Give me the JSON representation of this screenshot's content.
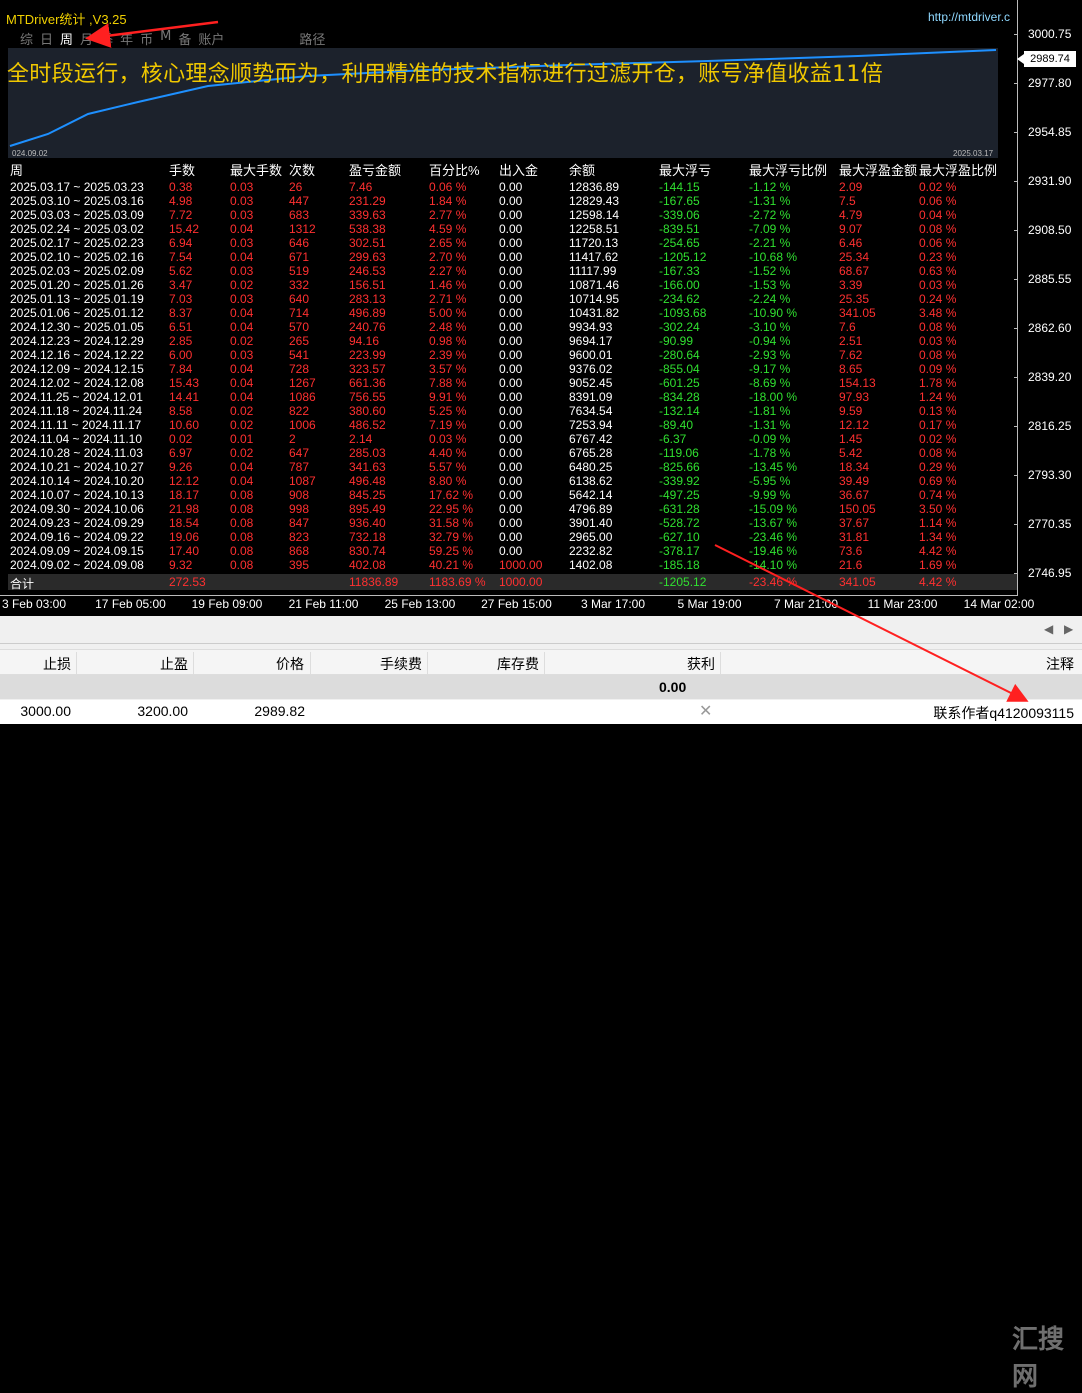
{
  "app": {
    "title": "MTDriver统计 ,V3.25",
    "url": "http://mtdriver.c"
  },
  "tabs": [
    "综",
    "日",
    "周",
    "月",
    "季",
    "年",
    "币",
    "M",
    "备",
    "账户",
    "路径"
  ],
  "active_tab": "周",
  "banner": "全时段运行，核心理念顺势而为，利用精准的技术指标进行过滤开仓，账号净值收益11倍",
  "mini_chart": {
    "start_label": "024.09.02",
    "end_label": "2025.03.17",
    "line_color": "#1e90ff",
    "bg": "#1c222c"
  },
  "price_axis": {
    "labels": [
      "3000.75",
      "2977.80",
      "2954.85",
      "2931.90",
      "2908.50",
      "2885.55",
      "2862.60",
      "2839.20",
      "2816.25",
      "2793.30",
      "2770.35",
      "2746.95"
    ],
    "current_price": "2989.74"
  },
  "time_axis": [
    "3 Feb 03:00",
    "17 Feb 05:00",
    "19 Feb 09:00",
    "21 Feb 11:00",
    "25 Feb 13:00",
    "27 Feb 15:00",
    "3 Mar 17:00",
    "5 Mar 19:00",
    "7 Mar 21:00",
    "11 Mar 23:00",
    "14 Mar 02:00"
  ],
  "table": {
    "headers": [
      "周",
      "手数",
      "最大手数",
      "次数",
      "盈亏金额",
      "百分比%",
      "出入金",
      "余额",
      "最大浮亏",
      "最大浮亏比例",
      "最大浮盈金额",
      "最大浮盈比例"
    ],
    "rows": [
      [
        "2025.03.17 ~ 2025.03.23",
        "0.38",
        "0.03",
        "26",
        "7.46",
        "0.06 %",
        "0.00",
        "12836.89",
        "-144.15",
        "-1.12 %",
        "2.09",
        "0.02 %"
      ],
      [
        "2025.03.10 ~ 2025.03.16",
        "4.98",
        "0.03",
        "447",
        "231.29",
        "1.84 %",
        "0.00",
        "12829.43",
        "-167.65",
        "-1.31 %",
        "7.5",
        "0.06 %"
      ],
      [
        "2025.03.03 ~ 2025.03.09",
        "7.72",
        "0.03",
        "683",
        "339.63",
        "2.77 %",
        "0.00",
        "12598.14",
        "-339.06",
        "-2.72 %",
        "4.79",
        "0.04 %"
      ],
      [
        "2025.02.24 ~ 2025.03.02",
        "15.42",
        "0.04",
        "1312",
        "538.38",
        "4.59 %",
        "0.00",
        "12258.51",
        "-839.51",
        "-7.09 %",
        "9.07",
        "0.08 %"
      ],
      [
        "2025.02.17 ~ 2025.02.23",
        "6.94",
        "0.03",
        "646",
        "302.51",
        "2.65 %",
        "0.00",
        "11720.13",
        "-254.65",
        "-2.21 %",
        "6.46",
        "0.06 %"
      ],
      [
        "2025.02.10 ~ 2025.02.16",
        "7.54",
        "0.04",
        "671",
        "299.63",
        "2.70 %",
        "0.00",
        "11417.62",
        "-1205.12",
        "-10.68 %",
        "25.34",
        "0.23 %"
      ],
      [
        "2025.02.03 ~ 2025.02.09",
        "5.62",
        "0.03",
        "519",
        "246.53",
        "2.27 %",
        "0.00",
        "11117.99",
        "-167.33",
        "-1.52 %",
        "68.67",
        "0.63 %"
      ],
      [
        "2025.01.20 ~ 2025.01.26",
        "3.47",
        "0.02",
        "332",
        "156.51",
        "1.46 %",
        "0.00",
        "10871.46",
        "-166.00",
        "-1.53 %",
        "3.39",
        "0.03 %"
      ],
      [
        "2025.01.13 ~ 2025.01.19",
        "7.03",
        "0.03",
        "640",
        "283.13",
        "2.71 %",
        "0.00",
        "10714.95",
        "-234.62",
        "-2.24 %",
        "25.35",
        "0.24 %"
      ],
      [
        "2025.01.06 ~ 2025.01.12",
        "8.37",
        "0.04",
        "714",
        "496.89",
        "5.00 %",
        "0.00",
        "10431.82",
        "-1093.68",
        "-10.90 %",
        "341.05",
        "3.48 %"
      ],
      [
        "2024.12.30 ~ 2025.01.05",
        "6.51",
        "0.04",
        "570",
        "240.76",
        "2.48 %",
        "0.00",
        "9934.93",
        "-302.24",
        "-3.10 %",
        "7.6",
        "0.08 %"
      ],
      [
        "2024.12.23 ~ 2024.12.29",
        "2.85",
        "0.02",
        "265",
        "94.16",
        "0.98 %",
        "0.00",
        "9694.17",
        "-90.99",
        "-0.94 %",
        "2.51",
        "0.03 %"
      ],
      [
        "2024.12.16 ~ 2024.12.22",
        "6.00",
        "0.03",
        "541",
        "223.99",
        "2.39 %",
        "0.00",
        "9600.01",
        "-280.64",
        "-2.93 %",
        "7.62",
        "0.08 %"
      ],
      [
        "2024.12.09 ~ 2024.12.15",
        "7.84",
        "0.04",
        "728",
        "323.57",
        "3.57 %",
        "0.00",
        "9376.02",
        "-855.04",
        "-9.17 %",
        "8.65",
        "0.09 %"
      ],
      [
        "2024.12.02 ~ 2024.12.08",
        "15.43",
        "0.04",
        "1267",
        "661.36",
        "7.88 %",
        "0.00",
        "9052.45",
        "-601.25",
        "-8.69 %",
        "154.13",
        "1.78 %"
      ],
      [
        "2024.11.25 ~ 2024.12.01",
        "14.41",
        "0.04",
        "1086",
        "756.55",
        "9.91 %",
        "0.00",
        "8391.09",
        "-834.28",
        "-18.00 %",
        "97.93",
        "1.24 %"
      ],
      [
        "2024.11.18 ~ 2024.11.24",
        "8.58",
        "0.02",
        "822",
        "380.60",
        "5.25 %",
        "0.00",
        "7634.54",
        "-132.14",
        "-1.81 %",
        "9.59",
        "0.13 %"
      ],
      [
        "2024.11.11 ~ 2024.11.17",
        "10.60",
        "0.02",
        "1006",
        "486.52",
        "7.19 %",
        "0.00",
        "7253.94",
        "-89.40",
        "-1.31 %",
        "12.12",
        "0.17 %"
      ],
      [
        "2024.11.04 ~ 2024.11.10",
        "0.02",
        "0.01",
        "2",
        "2.14",
        "0.03 %",
        "0.00",
        "6767.42",
        "-6.37",
        "-0.09 %",
        "1.45",
        "0.02 %"
      ],
      [
        "2024.10.28 ~ 2024.11.03",
        "6.97",
        "0.02",
        "647",
        "285.03",
        "4.40 %",
        "0.00",
        "6765.28",
        "-119.06",
        "-1.78 %",
        "5.42",
        "0.08 %"
      ],
      [
        "2024.10.21 ~ 2024.10.27",
        "9.26",
        "0.04",
        "787",
        "341.63",
        "5.57 %",
        "0.00",
        "6480.25",
        "-825.66",
        "-13.45 %",
        "18.34",
        "0.29 %"
      ],
      [
        "2024.10.14 ~ 2024.10.20",
        "12.12",
        "0.04",
        "1087",
        "496.48",
        "8.80 %",
        "0.00",
        "6138.62",
        "-339.92",
        "-5.95 %",
        "39.49",
        "0.69 %"
      ],
      [
        "2024.10.07 ~ 2024.10.13",
        "18.17",
        "0.08",
        "908",
        "845.25",
        "17.62 %",
        "0.00",
        "5642.14",
        "-497.25",
        "-9.99 %",
        "36.67",
        "0.74 %"
      ],
      [
        "2024.09.30 ~ 2024.10.06",
        "21.98",
        "0.08",
        "998",
        "895.49",
        "22.95 %",
        "0.00",
        "4796.89",
        "-631.28",
        "-15.09 %",
        "150.05",
        "3.50 %"
      ],
      [
        "2024.09.23 ~ 2024.09.29",
        "18.54",
        "0.08",
        "847",
        "936.40",
        "31.58 %",
        "0.00",
        "3901.40",
        "-528.72",
        "-13.67 %",
        "37.67",
        "1.14 %"
      ],
      [
        "2024.09.16 ~ 2024.09.22",
        "19.06",
        "0.08",
        "823",
        "732.18",
        "32.79 %",
        "0.00",
        "2965.00",
        "-627.10",
        "-23.46 %",
        "31.81",
        "1.34 %"
      ],
      [
        "2024.09.09 ~ 2024.09.15",
        "17.40",
        "0.08",
        "868",
        "830.74",
        "59.25 %",
        "0.00",
        "2232.82",
        "-378.17",
        "-19.46 %",
        "73.6",
        "4.42 %"
      ],
      [
        "2024.09.02 ~ 2024.09.08",
        "9.32",
        "0.08",
        "395",
        "402.08",
        "40.21 %",
        "1000.00",
        "1402.08",
        "-185.18",
        "-14.10 %",
        "21.6",
        "1.69 %"
      ]
    ],
    "total": {
      "label": "合计",
      "lots": "272.53",
      "pnl": "11836.89",
      "pct": "1183.69 %",
      "deposit": "1000.00",
      "max_dd": "-1205.12",
      "max_dd_pct": "-23.46 %",
      "max_fp": "341.05",
      "max_fp_pct": "4.42 %"
    }
  },
  "bottom": {
    "columns": [
      "止损",
      "止盈",
      "价格",
      "手续费",
      "库存费",
      "获利",
      "注释"
    ],
    "sum_value": "0.00",
    "row": {
      "sl": "3000.00",
      "tp": "3200.00",
      "price": "2989.82",
      "comment": "联系作者q4120093115"
    },
    "watermark": "汇搜网"
  }
}
